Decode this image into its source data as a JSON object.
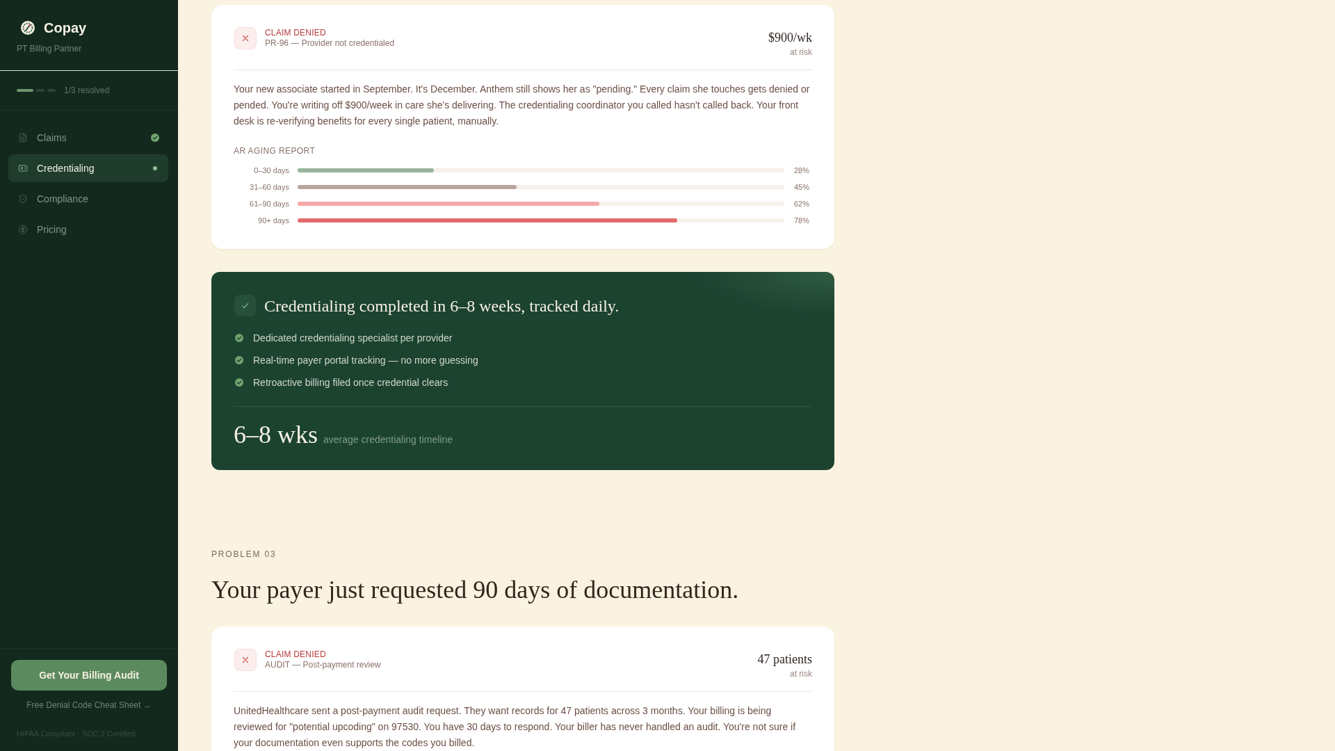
{
  "sidebar": {
    "brand": "Copay",
    "tagline": "PT Billing Partner",
    "progress": {
      "segments": [
        {
          "done": true
        },
        {
          "done": false
        },
        {
          "done": false
        }
      ],
      "label": "1/3 resolved"
    },
    "nav": [
      {
        "label": "Claims",
        "selected": false,
        "resolved": true
      },
      {
        "label": "Credentialing",
        "selected": true,
        "resolved": false
      },
      {
        "label": "Compliance",
        "selected": false,
        "resolved": false
      },
      {
        "label": "Pricing",
        "selected": false,
        "resolved": false
      }
    ],
    "cta": "Get Your Billing Audit",
    "link": "Free Denial Code Cheat Sheet →",
    "footer": "HIPAA Compliant · SOC 2 Certified"
  },
  "claim_card": {
    "status": "CLAIM DENIED",
    "code": "PR-96 — Provider not credentialed",
    "amount": "$900/wk",
    "amount_note": "at risk",
    "description": "Your new associate started in September. It's December. Anthem still shows her as \"pending.\" Every claim she touches gets denied or pended. You're writing off $900/week in care she's delivering. The credentialing coordinator you called hasn't called back. Your front desk is re-verifying benefits for every single patient, manually.",
    "report": {
      "title": "AR AGING REPORT",
      "rows": [
        {
          "label": "0–30 days",
          "level": 0.28,
          "reading": "28%",
          "color": "#97b59b"
        },
        {
          "label": "31–60 days",
          "level": 0.45,
          "reading": "45%",
          "color": "#b9a49e"
        },
        {
          "label": "61–90 days",
          "level": 0.62,
          "reading": "62%",
          "color": "#f5a8a8"
        },
        {
          "label": "90+ days",
          "level": 0.78,
          "reading": "78%",
          "color": "#e26b6b"
        }
      ]
    }
  },
  "solution_card": {
    "title": "Credentialing completed in 6–8 weeks, tracked daily.",
    "points": [
      "Dedicated credentialing specialist per provider",
      "Real-time payer portal tracking — no more guessing",
      "Retroactive billing filed once credential clears"
    ],
    "stat": "6–8 wks",
    "stat_note": "average credentialing timeline"
  },
  "problem": {
    "eyebrow": "PROBLEM 03",
    "heading": "Your payer just requested 90 days of documentation.",
    "claim_card": {
      "status": "CLAIM DENIED",
      "code": "AUDIT — Post-payment review",
      "amount": "47 patients",
      "amount_note": "at risk",
      "description": "UnitedHealthcare sent a post-payment audit request. They want records for 47 patients across 3 months. Your billing is being reviewed for \"potential upcoding\" on 97530. You have 30 days to respond. Your biller has never handled an audit. You're not sure if your documentation even supports the codes you billed."
    }
  }
}
